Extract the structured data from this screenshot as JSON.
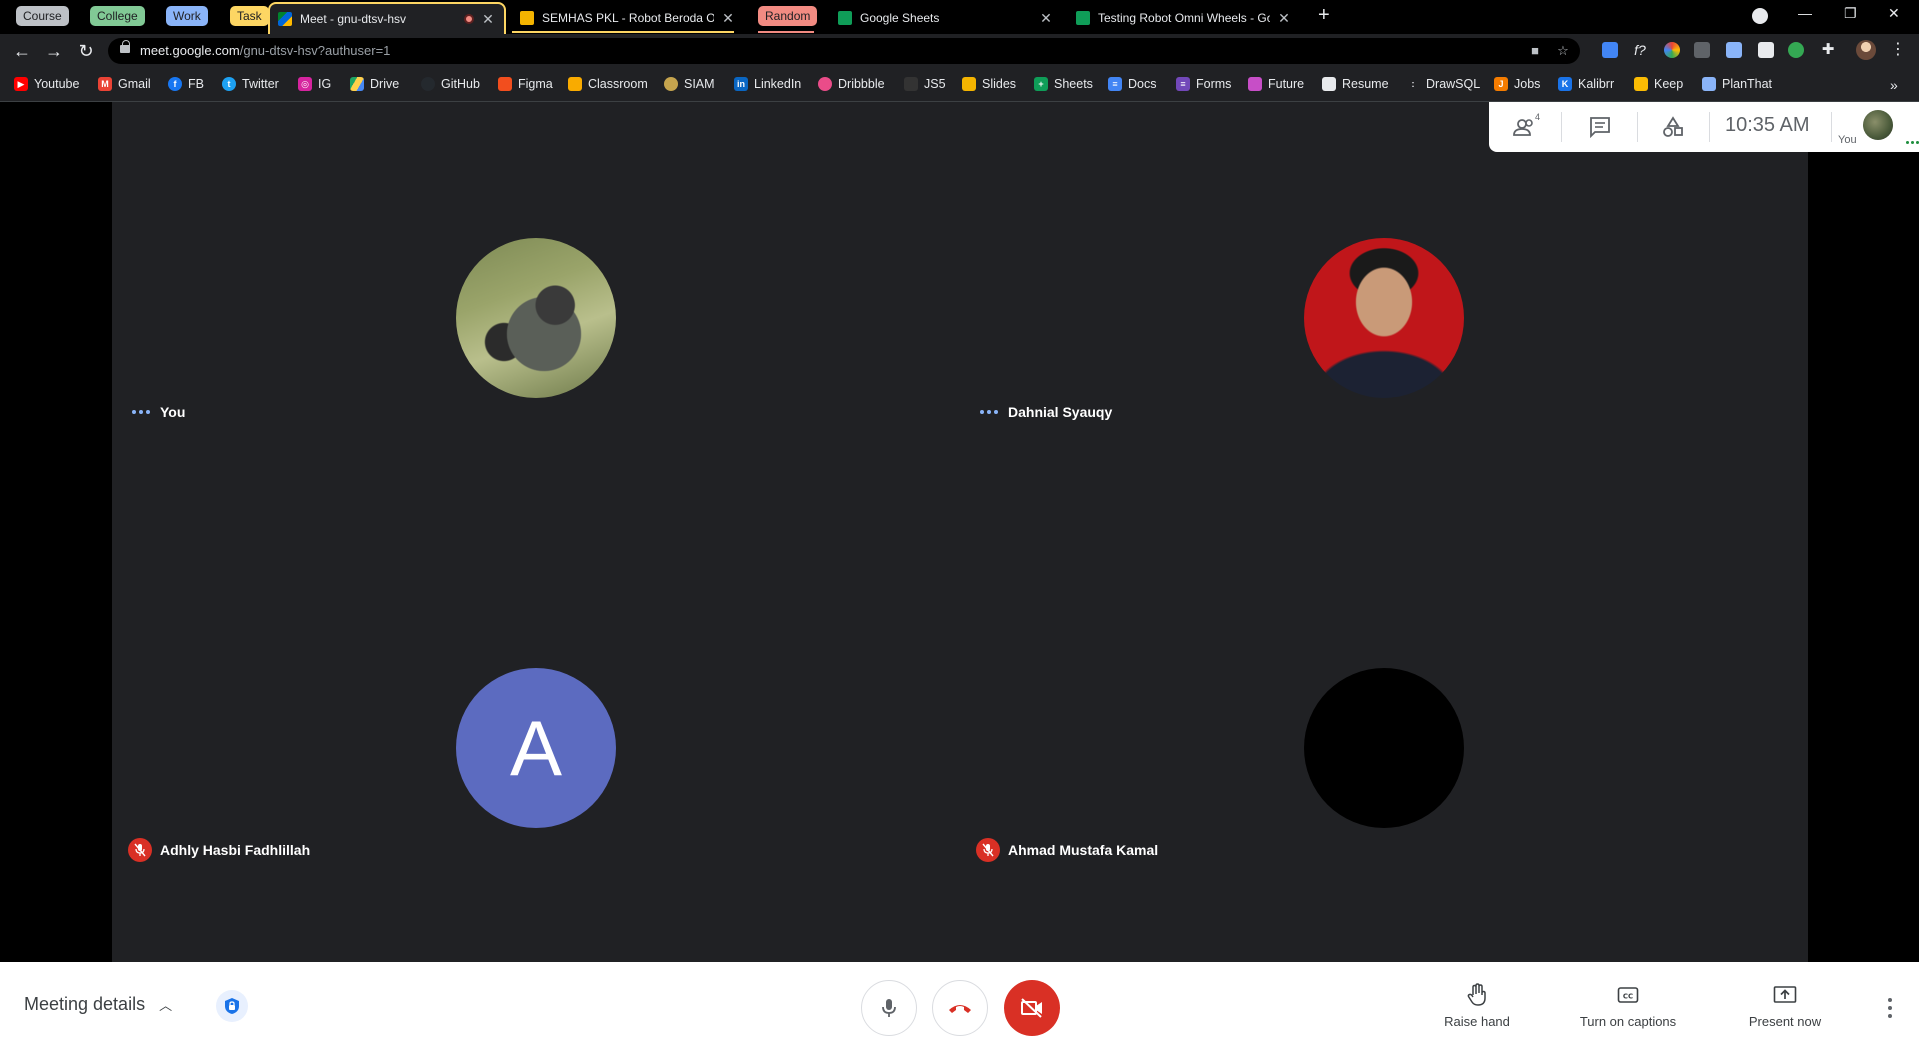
{
  "browser": {
    "tab_groups": [
      {
        "label": "Course",
        "color": "#bdc1c6"
      },
      {
        "label": "College",
        "color": "#81c995"
      },
      {
        "label": "Work",
        "color": "#8ab4f8"
      },
      {
        "label": "Task",
        "color": "#fdd663"
      },
      {
        "label": "Random",
        "color": "#f28b82"
      }
    ],
    "tabs": [
      {
        "title": "Meet - gnu-dtsv-hsv",
        "active": true
      },
      {
        "title": "SEMHAS PKL - Robot Beroda Om"
      },
      {
        "title": "Google Sheets"
      },
      {
        "title": "Testing Robot Omni Wheels - Go"
      }
    ],
    "url_host": "meet.google.com",
    "url_path": "/gnu-dtsv-hsv?authuser=1",
    "bookmarks": [
      {
        "label": "Youtube",
        "icon": "youtube-icon",
        "color": "#ff0000"
      },
      {
        "label": "Gmail",
        "icon": "gmail-icon",
        "color": "#ea4335"
      },
      {
        "label": "FB",
        "icon": "facebook-icon",
        "color": "#1877f2"
      },
      {
        "label": "Twitter",
        "icon": "twitter-icon",
        "color": "#1da1f2"
      },
      {
        "label": "IG",
        "icon": "instagram-icon",
        "color": "#d6249f"
      },
      {
        "label": "Drive",
        "icon": "drive-icon",
        "color": "#1fa463"
      },
      {
        "label": "GitHub",
        "icon": "github-icon",
        "color": "#24292e"
      },
      {
        "label": "Figma",
        "icon": "figma-icon",
        "color": "#f24e1e"
      },
      {
        "label": "Classroom",
        "icon": "classroom-icon",
        "color": "#f9ab00"
      },
      {
        "label": "SIAM",
        "icon": "siam-icon",
        "color": "#c5a44e"
      },
      {
        "label": "LinkedIn",
        "icon": "linkedin-icon",
        "color": "#0a66c2"
      },
      {
        "label": "Dribbble",
        "icon": "dribbble-icon",
        "color": "#ea4c89"
      },
      {
        "label": "JS5",
        "icon": "js5-icon",
        "color": "#333333"
      },
      {
        "label": "Slides",
        "icon": "slides-icon",
        "color": "#f4b400"
      },
      {
        "label": "Sheets",
        "icon": "sheets-icon",
        "color": "#0f9d58"
      },
      {
        "label": "Docs",
        "icon": "docs-icon",
        "color": "#4285f4"
      },
      {
        "label": "Forms",
        "icon": "forms-icon",
        "color": "#7248b9"
      },
      {
        "label": "Future",
        "icon": "future-icon",
        "color": "#c74ec7"
      },
      {
        "label": "Resume",
        "icon": "resume-icon",
        "color": "#e8eaed"
      },
      {
        "label": "DrawSQL",
        "icon": "drawsql-icon",
        "color": "#202124"
      },
      {
        "label": "Jobs",
        "icon": "jobs-icon",
        "color": "#f57c00"
      },
      {
        "label": "Kalibrr",
        "icon": "kalibrr-icon",
        "color": "#1a73e8"
      },
      {
        "label": "Keep",
        "icon": "keep-icon",
        "color": "#fbbc04"
      },
      {
        "label": "PlanThat",
        "icon": "planthat-icon",
        "color": "#8ab4f8"
      }
    ]
  },
  "meet": {
    "participant_count": "4",
    "clock": "10:35 AM",
    "self_label": "You",
    "participants": [
      {
        "name": "You",
        "status": "speaking-dots",
        "avatar": "photo"
      },
      {
        "name": "Dahnial Syauqy",
        "status": "speaking-dots",
        "avatar": "photo"
      },
      {
        "name": "Adhly Hasbi Fadhlillah",
        "status": "muted",
        "avatar": "letter",
        "initial": "A",
        "avatar_color": "#5c6bc0"
      },
      {
        "name": "Ahmad Mustafa Kamal",
        "status": "muted",
        "avatar": "blank",
        "avatar_color": "#000000"
      }
    ],
    "controls": {
      "meeting_details": "Meeting details",
      "raise_hand": "Raise hand",
      "captions": "Turn on captions",
      "present": "Present now"
    },
    "colors": {
      "end_call": "#d93025",
      "camera_off": "#d93025",
      "stage_bg": "#202124"
    }
  }
}
